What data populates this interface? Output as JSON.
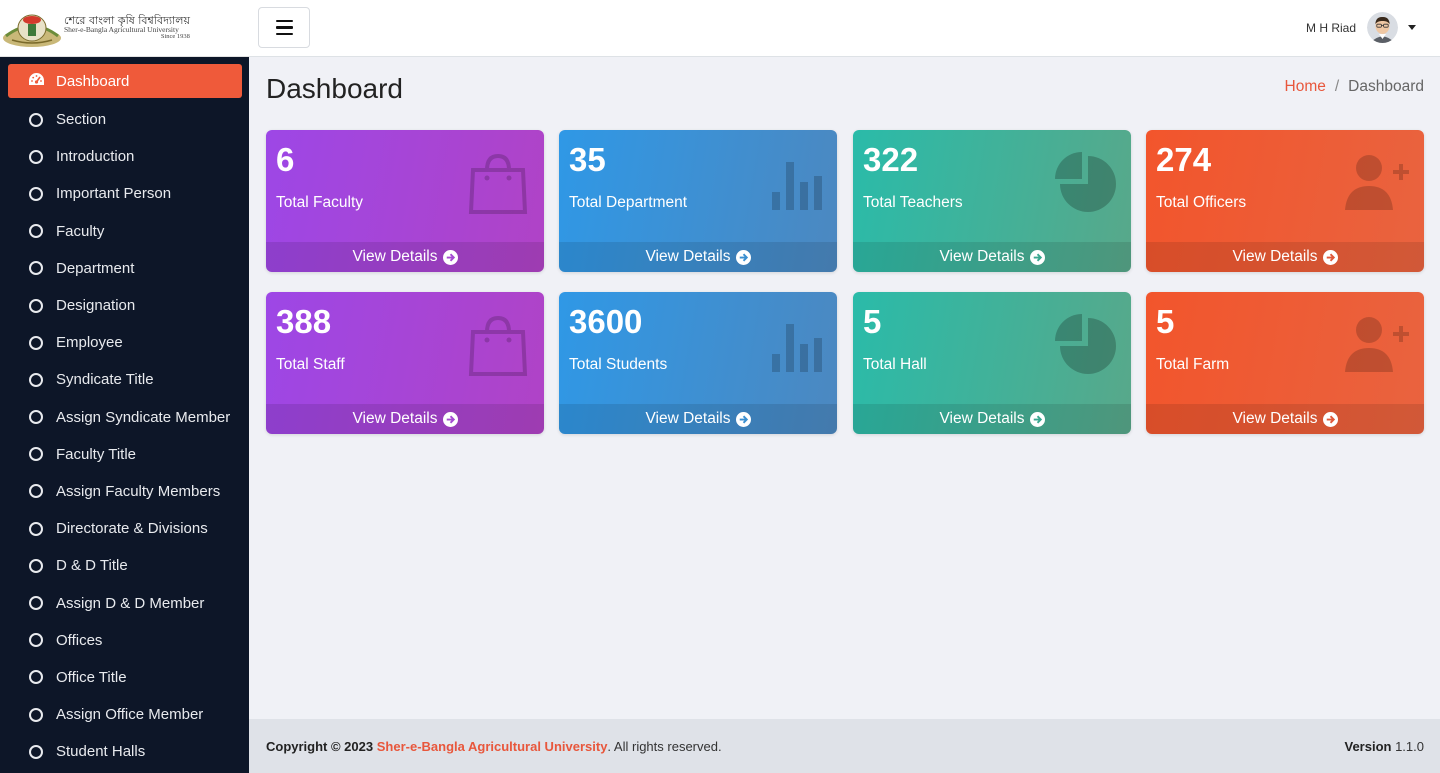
{
  "brand": {
    "bengali_name": "শেরে বাংলা কৃষি বিশ্ববিদ্যালয়",
    "english_name": "Sher-e-Bangla Agricultural University",
    "since": "Since 1938"
  },
  "sidebar": {
    "items": [
      {
        "label": "Dashboard",
        "icon": "dashboard-icon",
        "active": true
      },
      {
        "label": "Section",
        "icon": "circle-icon"
      },
      {
        "label": "Introduction",
        "icon": "circle-icon"
      },
      {
        "label": "Important Person",
        "icon": "circle-icon"
      },
      {
        "label": "Faculty",
        "icon": "circle-icon"
      },
      {
        "label": "Department",
        "icon": "circle-icon"
      },
      {
        "label": "Designation",
        "icon": "circle-icon"
      },
      {
        "label": "Employee",
        "icon": "circle-icon"
      },
      {
        "label": "Syndicate Title",
        "icon": "circle-icon"
      },
      {
        "label": "Assign Syndicate Member",
        "icon": "circle-icon"
      },
      {
        "label": "Faculty Title",
        "icon": "circle-icon"
      },
      {
        "label": "Assign Faculty Members",
        "icon": "circle-icon"
      },
      {
        "label": "Directorate & Divisions",
        "icon": "circle-icon"
      },
      {
        "label": "D & D Title",
        "icon": "circle-icon"
      },
      {
        "label": "Assign D & D Member",
        "icon": "circle-icon"
      },
      {
        "label": "Offices",
        "icon": "circle-icon"
      },
      {
        "label": "Office Title",
        "icon": "circle-icon"
      },
      {
        "label": "Assign Office Member",
        "icon": "circle-icon"
      },
      {
        "label": "Student Halls",
        "icon": "circle-icon"
      }
    ]
  },
  "header": {
    "menu_icon": "hamburger-menu-icon",
    "user_name": "M H Riad"
  },
  "page": {
    "title": "Dashboard",
    "breadcrumb": {
      "home": "Home",
      "separator": "/",
      "current": "Dashboard"
    }
  },
  "cards": [
    {
      "value": "6",
      "label": "Total Faculty",
      "link": "View Details",
      "icon": "shopping-bag-icon",
      "color": "#9d47e6"
    },
    {
      "value": "35",
      "label": "Total Department",
      "link": "View Details",
      "icon": "bar-chart-icon",
      "color": "#2f98e6"
    },
    {
      "value": "322",
      "label": "Total Teachers",
      "link": "View Details",
      "icon": "pie-chart-icon",
      "color": "#2abba9"
    },
    {
      "value": "274",
      "label": "Total Officers",
      "link": "View Details",
      "icon": "user-plus-icon",
      "color": "#f2552c"
    },
    {
      "value": "388",
      "label": "Total Staff",
      "link": "View Details",
      "icon": "shopping-bag-icon",
      "color": "#9d47e6"
    },
    {
      "value": "3600",
      "label": "Total Students",
      "link": "View Details",
      "icon": "bar-chart-icon",
      "color": "#2f98e6"
    },
    {
      "value": "5",
      "label": "Total Hall",
      "link": "View Details",
      "icon": "pie-chart-icon",
      "color": "#2abba9"
    },
    {
      "value": "5",
      "label": "Total Farm",
      "link": "View Details",
      "icon": "user-plus-icon",
      "color": "#f2552c"
    }
  ],
  "footer": {
    "copyright": "Copyright © 2023",
    "university": "Sher-e-Bangla Agricultural University",
    "rights": ". All rights reserved.",
    "version_label": "Version",
    "version": "1.1.0"
  }
}
